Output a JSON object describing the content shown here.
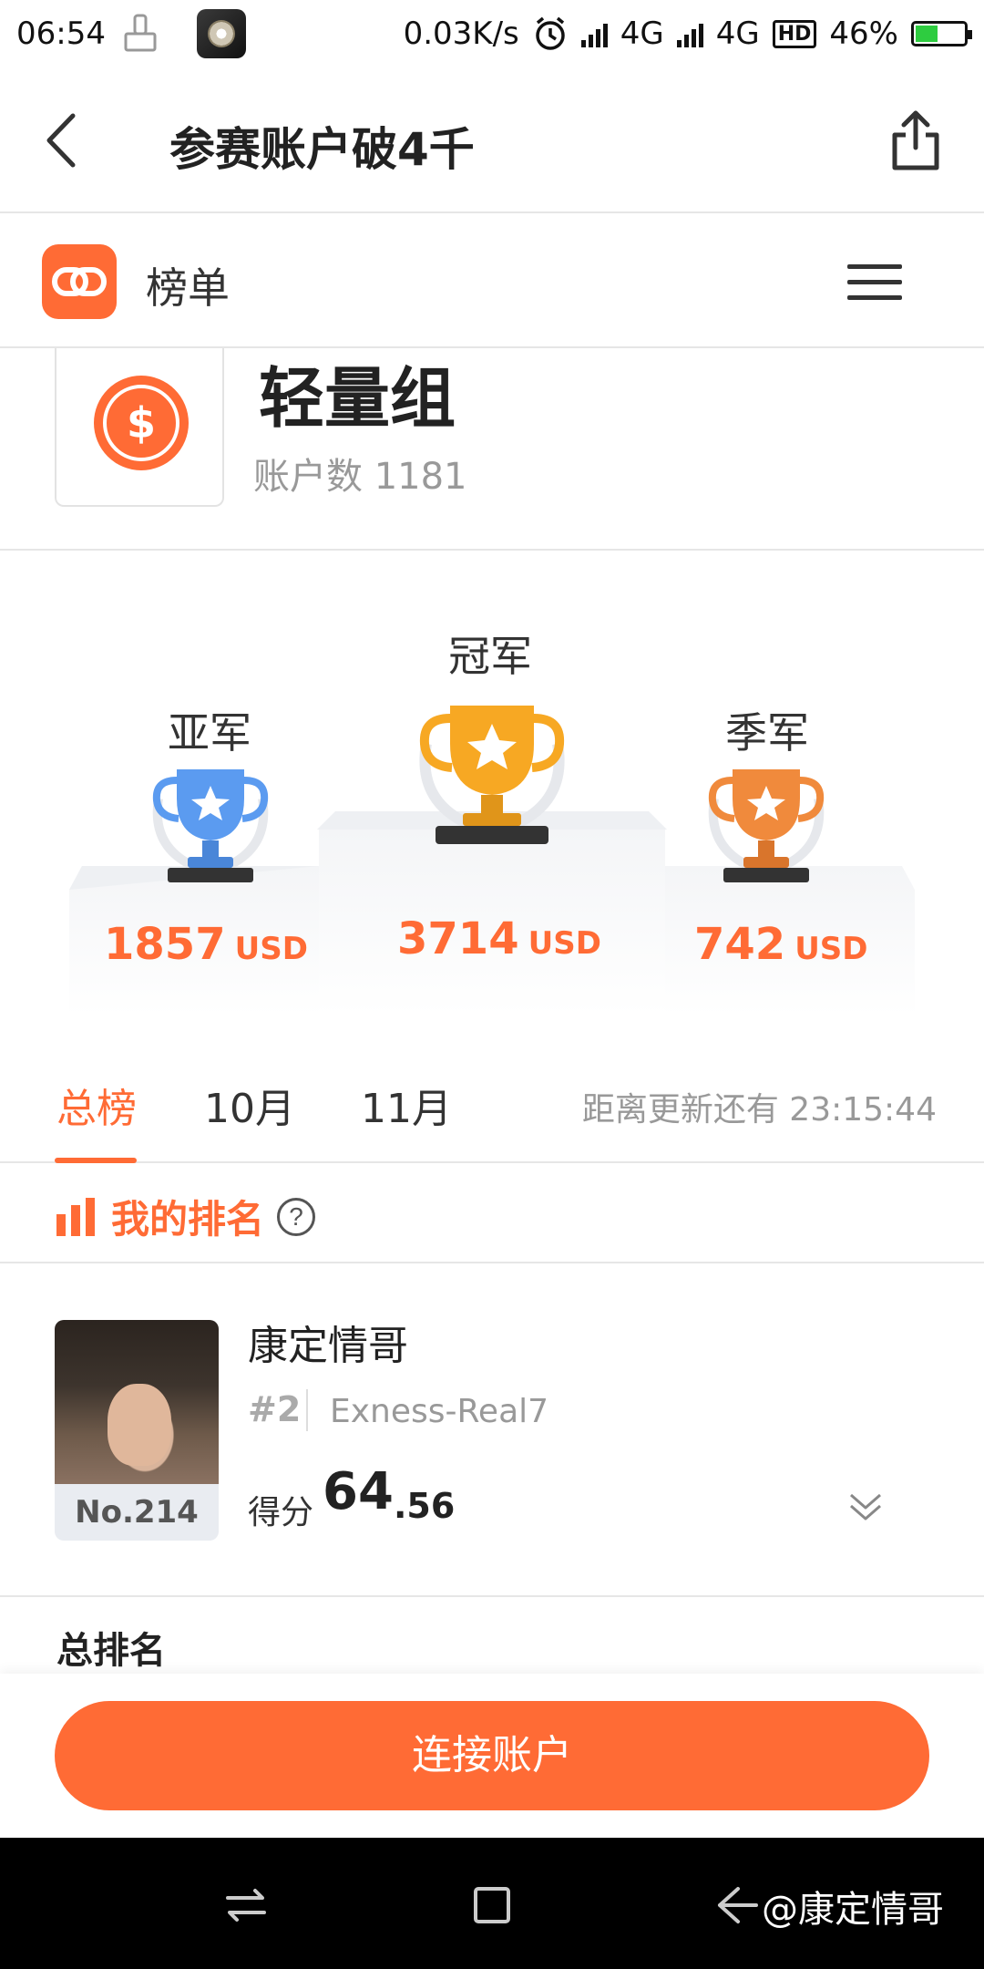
{
  "status_bar": {
    "time": "06:54",
    "speed": "0.03K/s",
    "net1": "4G",
    "net2": "4G",
    "hd": "HD",
    "battery": "46%"
  },
  "nav": {
    "title": "参赛账户破4千"
  },
  "sub_header": {
    "title": "榜单"
  },
  "group": {
    "name": "轻量组",
    "count_label": "账户数 1181"
  },
  "podium": {
    "first": {
      "label": "冠军",
      "value": "3714",
      "unit": "USD"
    },
    "second": {
      "label": "亚军",
      "value": "1857",
      "unit": "USD"
    },
    "third": {
      "label": "季军",
      "value": "742",
      "unit": "USD"
    }
  },
  "tabs": {
    "items": [
      "总榜",
      "10月",
      "11月"
    ],
    "countdown": "距离更新还有 23:15:44"
  },
  "my_rank": {
    "title": "我的排名",
    "help": "?",
    "user": {
      "no": "No.214",
      "name": "康定情哥",
      "rank": "#2",
      "account": "Exness-Real7",
      "score_label": "得分",
      "score_int": "64",
      "score_dec": ".56"
    }
  },
  "total": {
    "title": "总排名"
  },
  "bottom": {
    "connect_label": "连接账户"
  },
  "watermark": "@康定情哥",
  "colors": {
    "accent": "#ff6b35",
    "gold": "#f7a823",
    "silver": "#5b9bf0",
    "bronze": "#f08a3c"
  }
}
